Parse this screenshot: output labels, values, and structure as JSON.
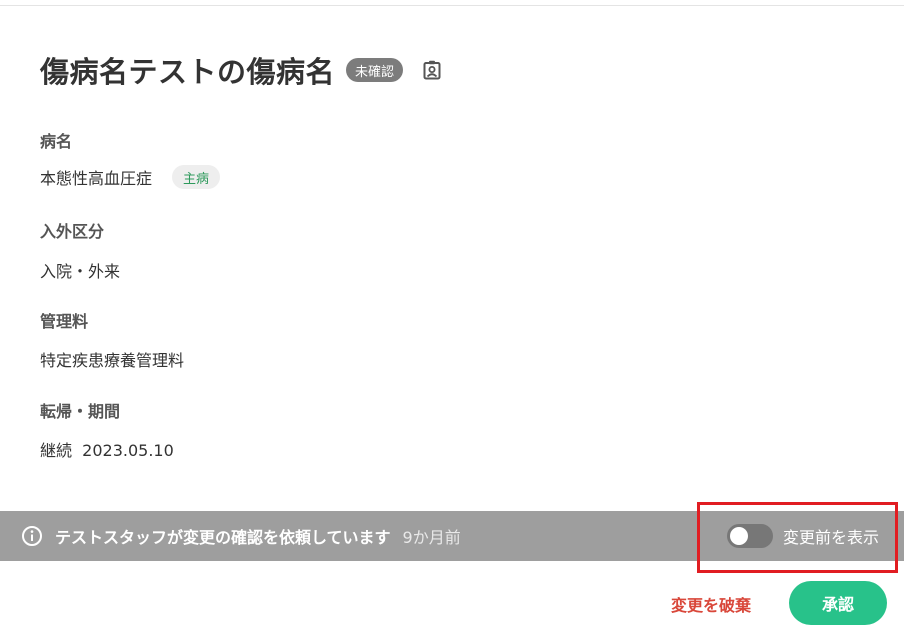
{
  "header": {
    "title": "傷病名テストの傷病名",
    "status_badge": "未確認",
    "id_icon": "id-card-icon"
  },
  "fields": {
    "disease": {
      "label": "病名",
      "value": "本態性高血圧症",
      "badge": "主病"
    },
    "admission_type": {
      "label": "入外区分",
      "value": "入院・外来"
    },
    "management_fee": {
      "label": "管理料",
      "value": "特定疾患療養管理料"
    },
    "outcome_period": {
      "label": "転帰・期間",
      "value": "継続  2023.05.10"
    }
  },
  "notice": {
    "icon": "info-icon",
    "message": "テストスタッフが変更の確認を依頼しています",
    "time": "9か月前",
    "toggle_label": "変更前を表示",
    "toggle_on": false
  },
  "actions": {
    "discard_label": "変更を破棄",
    "approve_label": "承認"
  },
  "colors": {
    "accent_green": "#28c28a",
    "discard_red": "#d9473a",
    "notice_gray": "#9e9e9e",
    "highlight_red": "#e11d22",
    "main_badge_green": "#2e9a5c"
  }
}
